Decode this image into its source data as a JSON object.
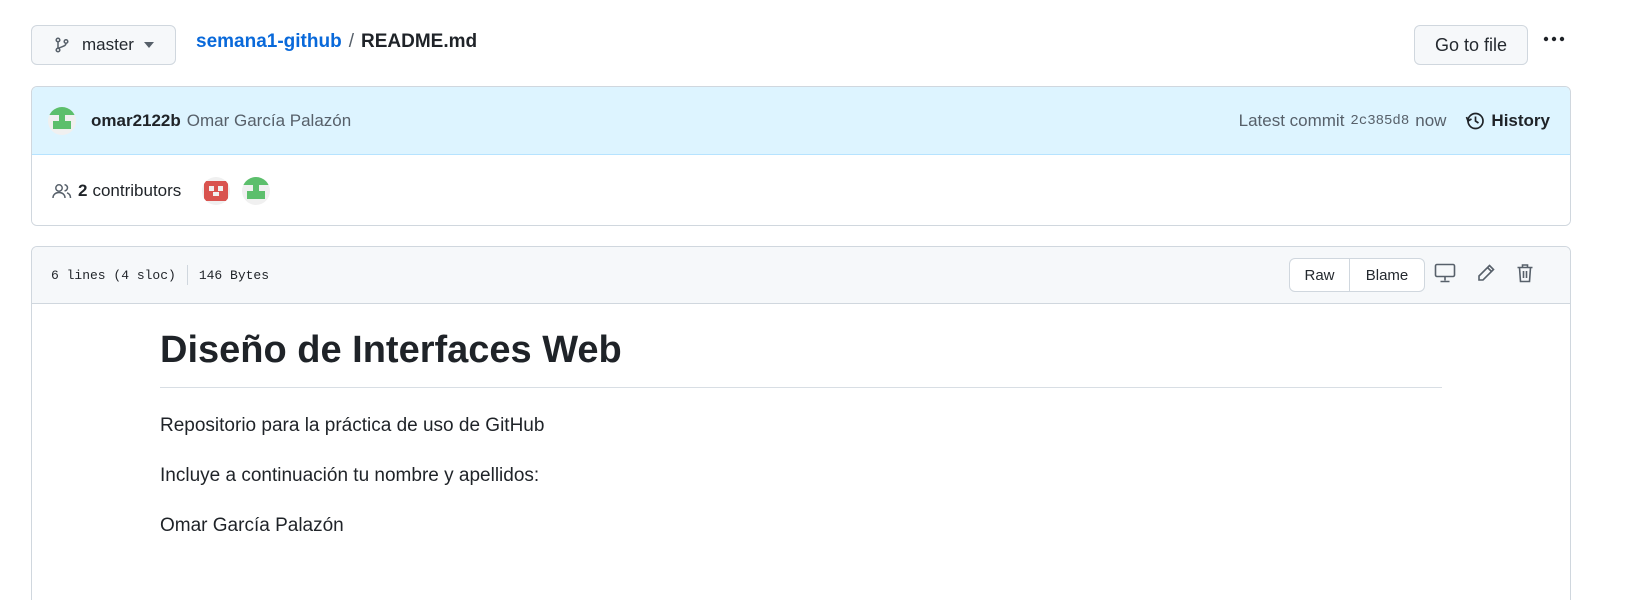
{
  "topbar": {
    "branch": "master",
    "repo": "semana1-github",
    "separator": "/",
    "file": "README.md",
    "goto_label": "Go to file",
    "more_icon": "kebab-horizontal-icon"
  },
  "commit": {
    "author": "omar2122b",
    "full_name": "Omar García Palazón",
    "latest_label": "Latest commit",
    "sha": "2c385d8",
    "time": "now",
    "history_label": "History"
  },
  "contributors": {
    "count": "2",
    "label": "contributors"
  },
  "file": {
    "lines": "6 lines (4 sloc)",
    "size": "146 Bytes",
    "raw_label": "Raw",
    "blame_label": "Blame"
  },
  "readme": {
    "title": "Diseño de Interfaces Web",
    "paragraphs": [
      "Repositorio para la práctica de uso de GitHub",
      "Incluye a continuación tu nombre y apellidos:",
      "Omar García Palazón"
    ]
  },
  "colors": {
    "link": "#0969da",
    "commit_bg": "#ddf4ff",
    "avatar_green": "#5cbf6c",
    "avatar_red": "#d9534f"
  }
}
